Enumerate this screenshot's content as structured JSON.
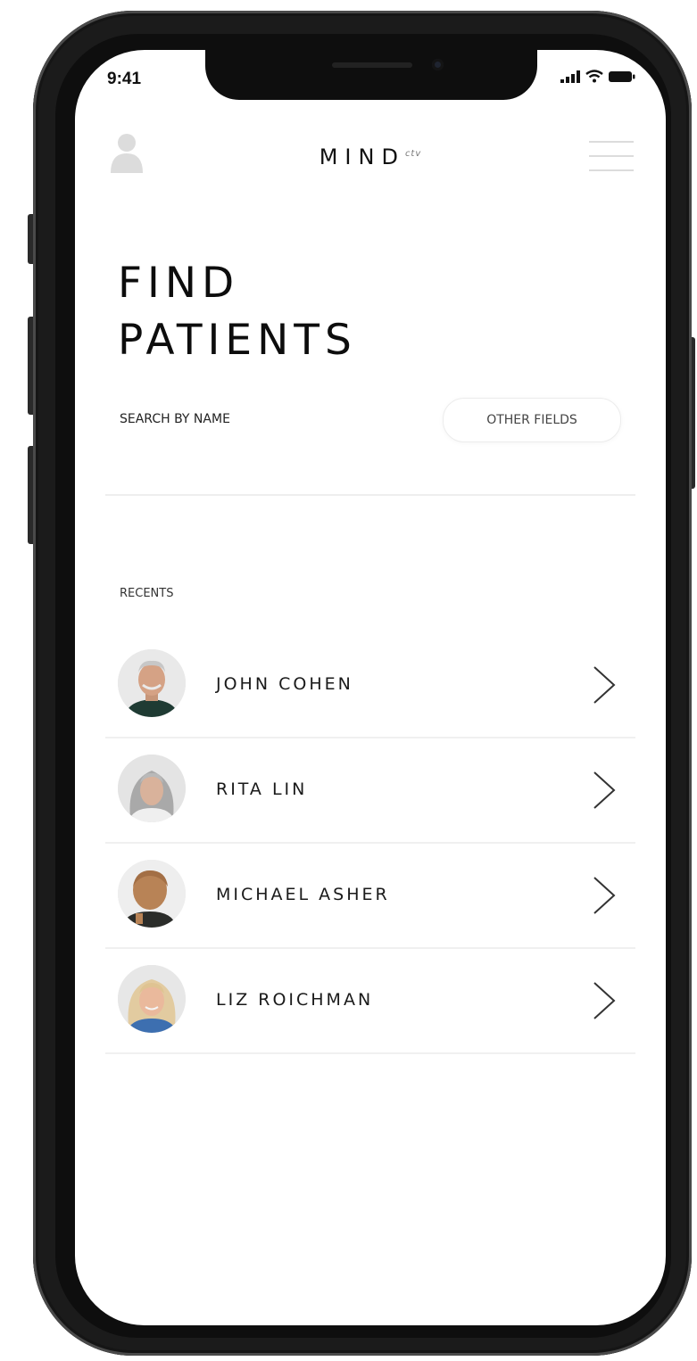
{
  "status_bar": {
    "time": "9:41"
  },
  "header": {
    "brand": "MIND",
    "brand_mark": "ctv"
  },
  "page": {
    "title_line1": "FIND",
    "title_line2": "PATIENTS"
  },
  "search": {
    "label": "SEARCH BY NAME",
    "other_fields_label": "OTHER FIELDS",
    "value": ""
  },
  "recents": {
    "label": "RECENTS",
    "patients": [
      {
        "name": "JOHN COHEN",
        "avatar": "avatar-photo-john"
      },
      {
        "name": "RITA LIN",
        "avatar": "avatar-photo-rita"
      },
      {
        "name": "MICHAEL ASHER",
        "avatar": "avatar-photo-michael"
      },
      {
        "name": "LIZ ROICHMAN",
        "avatar": "avatar-photo-liz"
      }
    ]
  },
  "icons": {
    "profile": "user-icon",
    "menu": "hamburger-menu-icon",
    "chevron": "chevron-right-icon",
    "signal": "cellular-signal-icon",
    "wifi": "wifi-icon",
    "battery": "battery-icon"
  },
  "colors": {
    "text": "#111111",
    "divider": "#f0f0f0",
    "frame": "#1b1b1b"
  }
}
